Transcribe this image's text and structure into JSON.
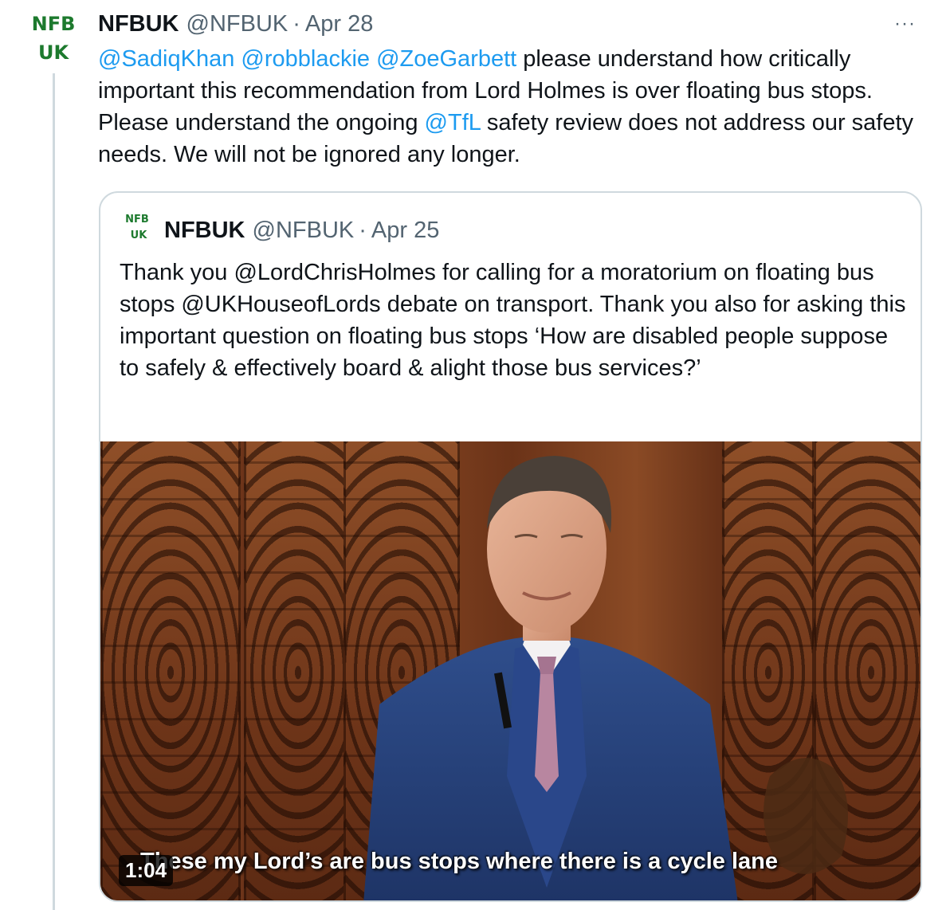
{
  "tweet": {
    "avatar": {
      "line1": "NFB",
      "line2": "UK",
      "color": "#1d7a2e"
    },
    "name": "NFBUK",
    "handle": "@NFBUK",
    "separator": "·",
    "date": "Apr 28",
    "more_icon": "more-horizontal-icon",
    "more_label": "···",
    "text_parts": [
      {
        "text": "@SadiqKhan",
        "link": true
      },
      {
        "text": " ",
        "link": false
      },
      {
        "text": "@robblackie",
        "link": true
      },
      {
        "text": " ",
        "link": false
      },
      {
        "text": "@ZoeGarbett",
        "link": true
      },
      {
        "text": " please understand how critically important this recommendation from Lord Holmes is over floating bus stops. Please understand the ongoing ",
        "link": false
      },
      {
        "text": "@TfL",
        "link": true
      },
      {
        "text": " safety review does not address our safety needs. We will not be ignored any longer.",
        "link": false
      }
    ],
    "link_color": "#1d9bf0"
  },
  "quote": {
    "avatar": {
      "line1": "NFB",
      "line2": "UK"
    },
    "name": "NFBUK",
    "handle": "@NFBUK",
    "separator": "·",
    "date": "Apr 25",
    "text": "Thank you @LordChrisHolmes for calling for a moratorium on floating bus stops @UKHouseofLords debate on transport.  Thank you also for asking this important question on floating bus stops ‘How are disabled people suppose to safely & effectively board & alight those bus services?’",
    "video": {
      "duration": "1:04",
      "caption": "These my Lord’s are bus stops where there is a cycle lane"
    }
  }
}
